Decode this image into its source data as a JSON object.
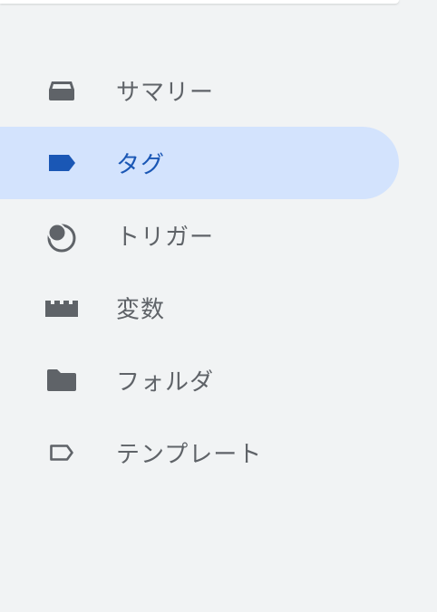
{
  "nav": {
    "items": [
      {
        "label": "サマリー",
        "icon": "inbox-tray-icon",
        "selected": false
      },
      {
        "label": "タグ",
        "icon": "tag-filled-icon",
        "selected": true
      },
      {
        "label": "トリガー",
        "icon": "trigger-circle-icon",
        "selected": false
      },
      {
        "label": "変数",
        "icon": "building-block-icon",
        "selected": false
      },
      {
        "label": "フォルダ",
        "icon": "folder-icon",
        "selected": false
      },
      {
        "label": "テンプレート",
        "icon": "tag-outline-icon",
        "selected": false
      }
    ]
  },
  "colors": {
    "background": "#f1f3f4",
    "selected_background": "#d3e3fd",
    "selected_text": "#1a57b5",
    "text": "#5f6368",
    "icon": "#5f6368",
    "selected_icon": "#1a57b5"
  }
}
